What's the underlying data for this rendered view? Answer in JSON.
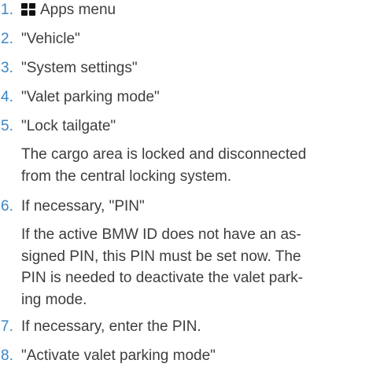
{
  "steps": [
    {
      "number": "1.",
      "text": "Apps menu",
      "icon": "apps-grid-icon"
    },
    {
      "number": "2.",
      "text": "\"Vehicle\""
    },
    {
      "number": "3.",
      "text": "\"System settings\""
    },
    {
      "number": "4.",
      "text": "\"Valet parking mode\""
    },
    {
      "number": "5.",
      "text": "\"Lock tailgate\"",
      "note_lines": [
        "The cargo area is locked and disconnected",
        "from the central locking system."
      ]
    },
    {
      "number": "6.",
      "text": "If necessary, \"PIN\"",
      "note_lines": [
        "If the active BMW ID does not have an as-",
        "signed PIN, this PIN must be set now. The",
        "PIN is needed to deactivate the valet park-",
        "ing mode."
      ]
    },
    {
      "number": "7.",
      "text": "If necessary, enter the PIN."
    },
    {
      "number": "8.",
      "text": "\"Activate valet parking mode\""
    }
  ],
  "colors": {
    "step_number": "#3b86c7",
    "text": "#3d3d3d",
    "icon": "#111111"
  }
}
